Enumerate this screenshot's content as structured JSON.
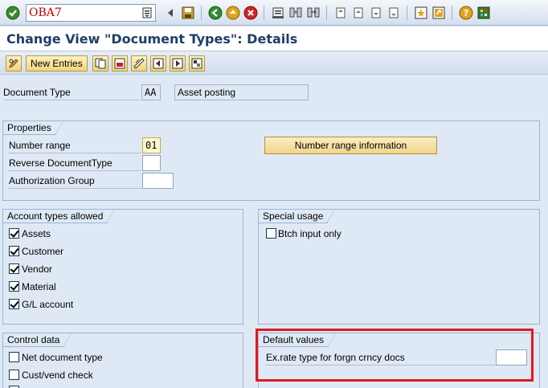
{
  "system_toolbar": {
    "command_field_value": "OBA7",
    "icons": [
      "enter-icon",
      "save-icon",
      "back-icon",
      "exit-icon",
      "cancel-icon",
      "print-icon",
      "find-icon",
      "find-next-icon",
      "first-page-icon",
      "previous-page-icon",
      "next-page-icon",
      "last-page-icon",
      "create-session-icon",
      "shortcut-icon",
      "help-icon",
      "customize-layout-icon"
    ]
  },
  "title": "Change View \"Document Types\": Details",
  "app_toolbar": {
    "new_entries_label": "New Entries"
  },
  "header": {
    "document_type_label": "Document Type",
    "document_type_value": "AA",
    "document_type_text": "Asset posting"
  },
  "properties": {
    "title": "Properties",
    "number_range_label": "Number range",
    "number_range_value": "01",
    "reverse_doctype_label": "Reverse DocumentType",
    "reverse_doctype_value": "",
    "authorization_group_label": "Authorization Group",
    "authorization_group_value": "",
    "number_range_info_button": "Number range information"
  },
  "account_types": {
    "title": "Account types allowed",
    "items": [
      {
        "label": "Assets",
        "checked": true
      },
      {
        "label": "Customer",
        "checked": true
      },
      {
        "label": "Vendor",
        "checked": true
      },
      {
        "label": "Material",
        "checked": true
      },
      {
        "label": "G/L account",
        "checked": true
      }
    ]
  },
  "special_usage": {
    "title": "Special usage",
    "batch_input_label": "Btch input only",
    "batch_input_checked": false
  },
  "control_data": {
    "title": "Control data",
    "net_document_label": "Net document type",
    "net_document_checked": false,
    "cust_vend_label": "Cust/vend check",
    "cust_vend_checked": false
  },
  "default_values": {
    "title": "Default values",
    "ex_rate_label": "Ex.rate type for forgn crncy docs",
    "ex_rate_value": ""
  },
  "colors": {
    "background": "#dfe9f5",
    "title_text": "#1e3f66",
    "highlight": "#e0191d",
    "command_text": "#c00000"
  }
}
